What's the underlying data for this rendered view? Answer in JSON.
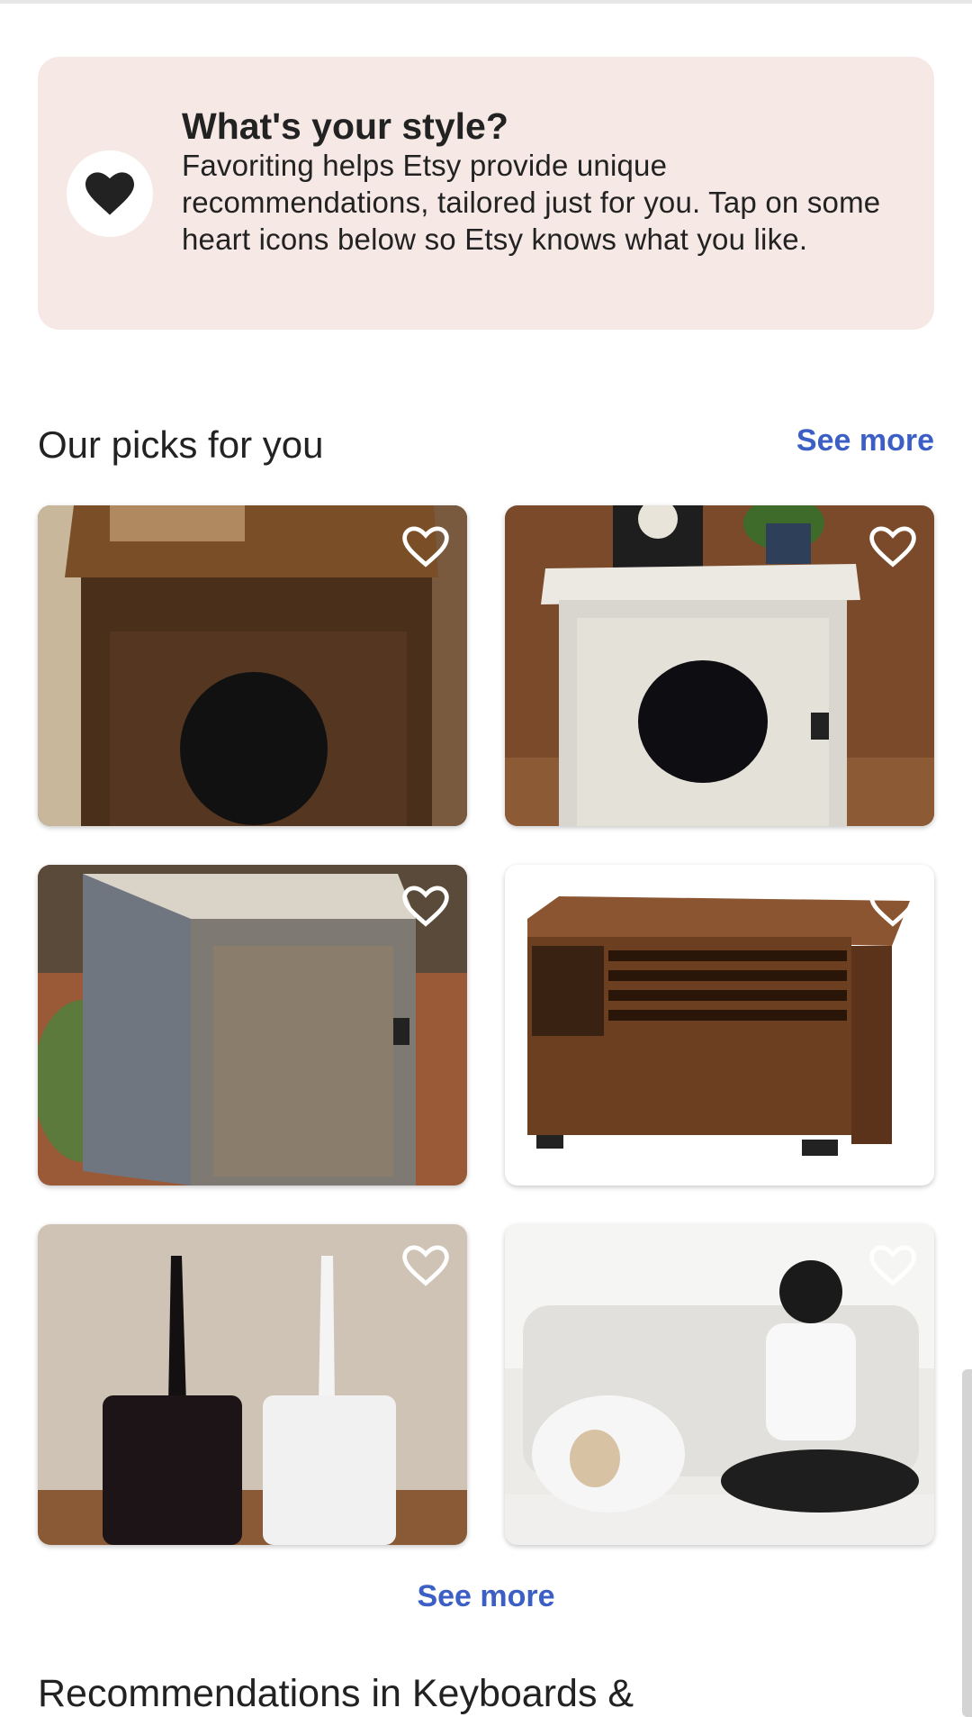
{
  "banner": {
    "title": "What's your style?",
    "text": "Favoriting helps Etsy provide unique recommendations, tailored just for you. Tap on some heart icons below so Etsy knows what you like.",
    "icon": "heart-icon"
  },
  "picks": {
    "title": "Our picks for you",
    "see_more_top": "See more",
    "see_more_bottom": "See more",
    "items": [
      {
        "name": "dark-wood-litter-cabinet",
        "favorite_icon": "heart-outline-icon"
      },
      {
        "name": "white-wash-litter-cabinet",
        "favorite_icon": "heart-outline-icon"
      },
      {
        "name": "rustic-grey-litter-cabinet",
        "favorite_icon": "heart-outline-icon"
      },
      {
        "name": "walnut-slatted-litter-cabinet",
        "favorite_icon": "heart-outline-icon"
      },
      {
        "name": "litter-scoop-holders",
        "favorite_icon": "heart-outline-icon"
      },
      {
        "name": "white-enclosed-litter-box",
        "favorite_icon": "heart-outline-icon"
      }
    ]
  },
  "next_section": {
    "title": "Recommendations in Keyboards &"
  },
  "colors": {
    "banner_bg": "#f6e8e4",
    "link": "#3b5fc4",
    "text": "#222222"
  }
}
